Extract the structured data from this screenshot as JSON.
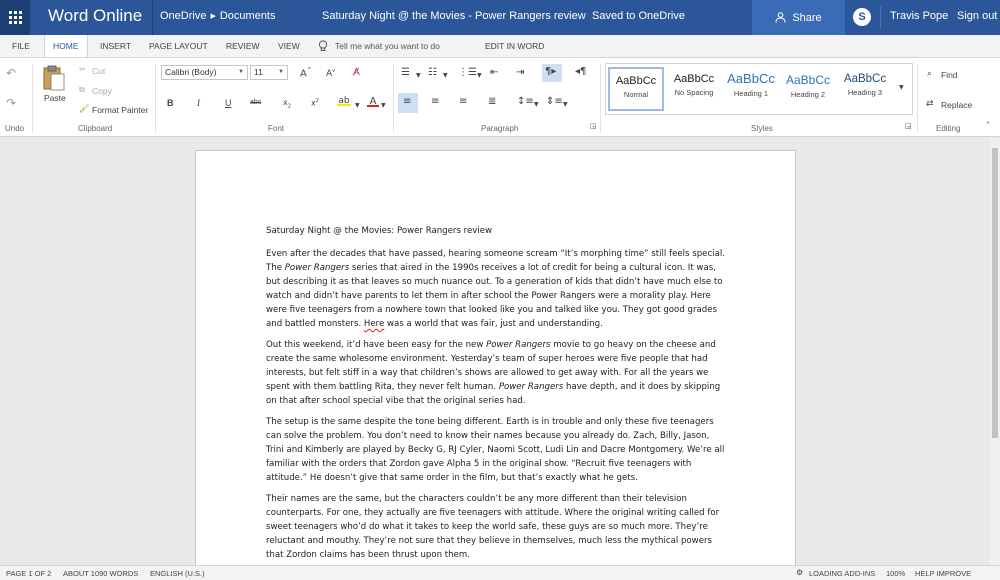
{
  "header": {
    "app_name": "Word Online",
    "breadcrumb": [
      "OneDrive",
      "Documents"
    ],
    "document_title": "Saturday Night @ the Movies - Power Rangers review",
    "save_status": "Saved to OneDrive",
    "share_label": "Share",
    "user_name": "Travis Pope",
    "sign_out": "Sign out",
    "accent_color": "#2b579a"
  },
  "tabs": [
    {
      "label": "FILE"
    },
    {
      "label": "HOME"
    },
    {
      "label": "INSERT"
    },
    {
      "label": "PAGE LAYOUT"
    },
    {
      "label": "REVIEW"
    },
    {
      "label": "VIEW"
    },
    {
      "label": "EDIT IN WORD"
    }
  ],
  "tell_me_placeholder": "Tell me what you want to do",
  "ribbon": {
    "undo": {
      "label": "Undo"
    },
    "clipboard": {
      "label": "Clipboard",
      "paste": "Paste",
      "cut": "Cut",
      "copy": "Copy",
      "format_painter": "Format Painter"
    },
    "font": {
      "label": "Font",
      "font_name": "Calibri (Body)",
      "font_size": "11"
    },
    "paragraph": {
      "label": "Paragraph"
    },
    "styles": {
      "label": "Styles",
      "items": [
        {
          "preview": "AaBbCc",
          "name": "Normal"
        },
        {
          "preview": "AaBbCc",
          "name": "No Spacing"
        },
        {
          "preview": "AaBbCc",
          "name": "Heading 1"
        },
        {
          "preview": "AaBbCc",
          "name": "Heading 2"
        },
        {
          "preview": "AaBbCc",
          "name": "Heading 3"
        }
      ]
    },
    "editing": {
      "label": "Editing",
      "find": "Find",
      "replace": "Replace"
    }
  },
  "document": {
    "heading": "Saturday Night @ the Movies: Power Rangers review",
    "p1": {
      "a": "Even after the decades that have passed, hearing someone scream “It’s morphing time” still feels special. The ",
      "b": "Power Rangers",
      "c": " series that aired in the 1990s receives a lot of credit for being a cultural icon. It was, but describing it as that leaves so much nuance out. To a generation of kids that didn’t have much else to watch and didn’t have parents to let them in after school the Power Rangers were a morality play. Here were five teenagers from a nowhere town that looked like you and talked like you. They got good grades and battled monsters. ",
      "d": "Here",
      "e": " was a world that was fair, just and understanding."
    },
    "p2": {
      "a": "Out this weekend, it’d have been easy for the new ",
      "b": "Power Rangers",
      "c": " movie to go heavy on the cheese and create the same wholesome environment. Yesterday’s team of super heroes were five people that had interests, but felt stiff in a way that children’s shows are allowed to get away with. For all the years we spent with them battling Rita, they never felt human. ",
      "d": "Power Rangers",
      "e": " have depth, and it does by skipping on that after school special vibe that the original series had."
    },
    "p3": "The setup is the same despite the tone being different. Earth is in trouble and only these five teenagers can solve the problem. You don’t need to know their names because you already do. Zach, Billy, Jason, Trini and Kimberly are played by Becky G, RJ Cyler, Naomi Scott, Ludi Lin and Dacre Montgomery. We’re all familiar with the orders that Zordon gave Alpha 5 in the original show. “Recruit five teenagers with attitude.” He doesn’t give that same order in the film, but that’s exactly what he gets.",
    "p4": "Their names are the same, but the characters couldn’t be any more different than their television counterparts. For one, they actually are five teenagers with attitude. Where the original writing called for sweet teenagers who’d do what it takes to keep the world safe, these guys are so much more. They’re reluctant and mouthy. They’re not sure that they believe in themselves, much less the mythical powers that Zordon claims has been thrust upon them."
  },
  "status": {
    "page": "PAGE 1 OF 2",
    "words": "ABOUT 1090 WORDS",
    "language": "ENGLISH (U.S.)",
    "addins": "LOADING ADD-INS",
    "zoom": "100%",
    "improve": "HELP IMPROVE OFFICE"
  }
}
